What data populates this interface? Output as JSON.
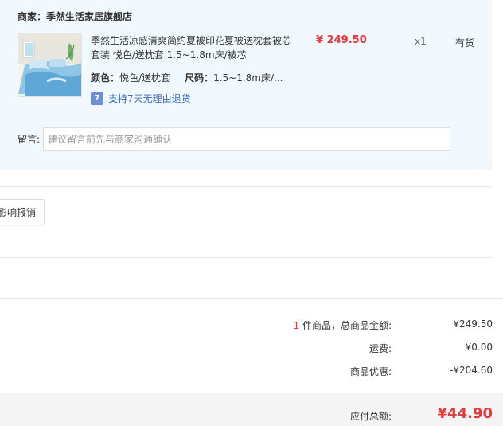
{
  "store": {
    "label": "商家：季然生活家居旗舰店"
  },
  "item": {
    "title": "季然生活凉感清爽简约夏被印花夏被送枕套被芯套装 悦色/送枕套 1.5~1.8m床/被芯",
    "color_key": "颜色：",
    "color_value": "悦色/送枕套",
    "size_key": "尺码：",
    "size_value": "1.5~1.8m床/...",
    "price": "¥ 249.50",
    "qty": "x1",
    "stock": "有货",
    "return_badge": "7",
    "return_text": "支持7天无理由退货",
    "thumb_icon": "bedding-product-image"
  },
  "note": {
    "label": "留言:",
    "placeholder": "建议留言前先与商家沟通确认"
  },
  "invoice": {
    "button": "影响报销"
  },
  "summary": {
    "count": "1",
    "goods_label": " 件商品，总商品金额:",
    "goods_value": "¥249.50",
    "shipping_label": "运费:",
    "shipping_value": "¥0.00",
    "discount_label": "商品优惠:",
    "discount_value": "-¥204.60",
    "total_label": "应付总额:",
    "total_value": "¥44.90"
  },
  "colors": {
    "accent": "#e4393c",
    "panel": "#f2f9fe",
    "link": "#3b6cc4"
  }
}
